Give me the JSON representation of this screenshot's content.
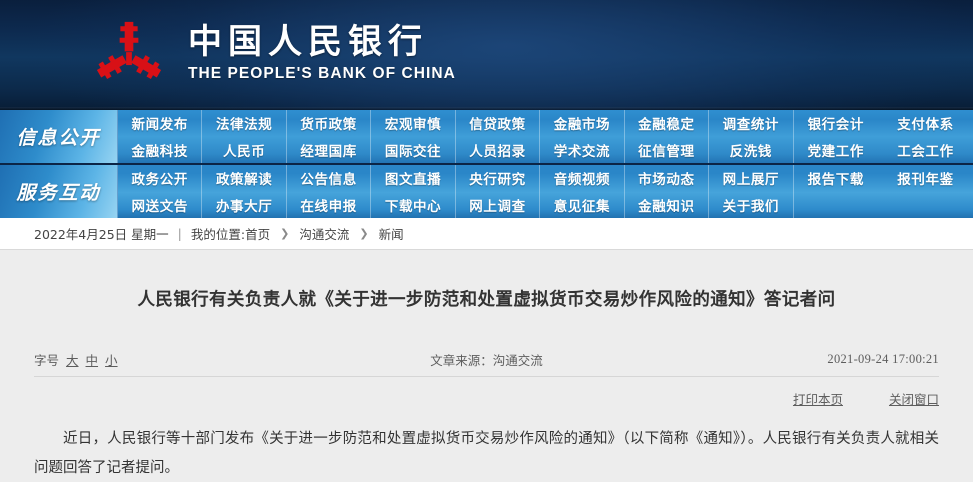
{
  "banner": {
    "logo_icon": "pboc-emblem-icon",
    "cn_name": "中国人民银行",
    "en_name": "THE PEOPLE'S BANK OF CHINA",
    "bg_color": "#0d2a4f"
  },
  "nav": {
    "accent_color": "#2f8fd0",
    "groups": [
      {
        "label": "信息公开",
        "items": [
          "新闻发布",
          "法律法规",
          "货币政策",
          "宏观审慎",
          "信贷政策",
          "金融市场",
          "金融稳定",
          "调查统计",
          "银行会计",
          "金融科技",
          "人民币",
          "经理国库",
          "国际交往",
          "人员招录",
          "学术交流",
          "征信管理",
          "反洗钱",
          "党建工作"
        ],
        "extra_col": [
          "支付体系",
          "工会工作"
        ]
      },
      {
        "label": "服务互动",
        "items": [
          "政务公开",
          "政策解读",
          "公告信息",
          "图文直播",
          "央行研究",
          "音频视频",
          "市场动态",
          "网上展厅",
          "报告下载",
          "网送文告",
          "办事大厅",
          "在线申报",
          "下载中心",
          "网上调查",
          "意见征集",
          "金融知识",
          "关于我们",
          ""
        ],
        "extra_col": [
          "报刊年鉴",
          ""
        ]
      }
    ]
  },
  "breadcrumb": {
    "date": "2022年4月25日 星期一",
    "separator": "|",
    "location_label": "我的位置:",
    "home": "首页",
    "arrow": "❯",
    "level2": "沟通交流",
    "level3": "新闻"
  },
  "article": {
    "title": "人民银行有关负责人就《关于进一步防范和处置虚拟货币交易炒作风险的通知》答记者问",
    "fontsize_label": "字号",
    "fontsize_options": [
      "大",
      "中",
      "小"
    ],
    "source": "文章来源：沟通交流",
    "timestamp": "2021-09-24 17:00:21",
    "actions": [
      "打印本页",
      "关闭窗口"
    ],
    "body": "近日，人民银行等十部门发布《关于进一步防范和处置虚拟货币交易炒作风险的通知》（以下简称《通知》）。人民银行有关负责人就相关问题回答了记者提问。"
  }
}
